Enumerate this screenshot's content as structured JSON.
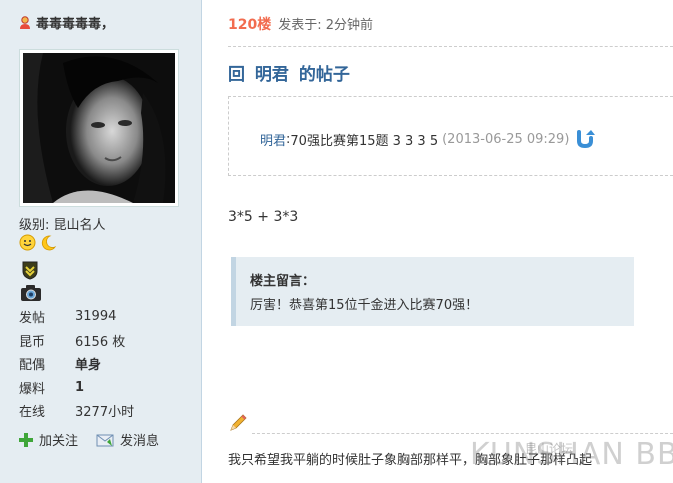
{
  "sidebar": {
    "username": "毒毒毒毒毒，",
    "level_label": "级别:",
    "level_value": "昆山名人",
    "stats": [
      {
        "label": "发帖",
        "value": "31994"
      },
      {
        "label": "昆币",
        "value": "6156 枚"
      },
      {
        "label": "配偶",
        "value": "单身"
      },
      {
        "label": "爆料",
        "value": "1"
      },
      {
        "label": "在线",
        "value": "3277小时"
      }
    ],
    "actions": {
      "follow": "加关注",
      "message": "发消息"
    },
    "icons": {
      "user": "user-icon",
      "medals": [
        "smiley-icon",
        "moon-icon",
        "shield-badge-icon",
        "camera-icon"
      ],
      "follow": "plus-icon",
      "message": "envelope-icon"
    }
  },
  "post": {
    "floor": "120楼",
    "posted_label": "发表于: 2分钟前",
    "reply_title": "回  明君  的帖子",
    "quote": {
      "author": "明君",
      "colon": ":",
      "text": "70强比赛第15题   3   3    3    5",
      "date": "(2013-06-25 09:29)"
    },
    "body": "3*5 + 3*3",
    "owner_note": {
      "label": "楼主留言：",
      "text": "厉害！恭喜第15位千金进入比赛70强！"
    },
    "signature": "我只希望我平躺的时候肚子象胸部那样平，胸部象肚子那样凸起",
    "watermark": "KUNSHAN BBS",
    "watermark_cn": "昆山论坛"
  },
  "colors": {
    "sidebar_bg": "#e5edf2",
    "floor": "#f26c4f",
    "title": "#336699",
    "note_bg": "#e5edf2"
  }
}
